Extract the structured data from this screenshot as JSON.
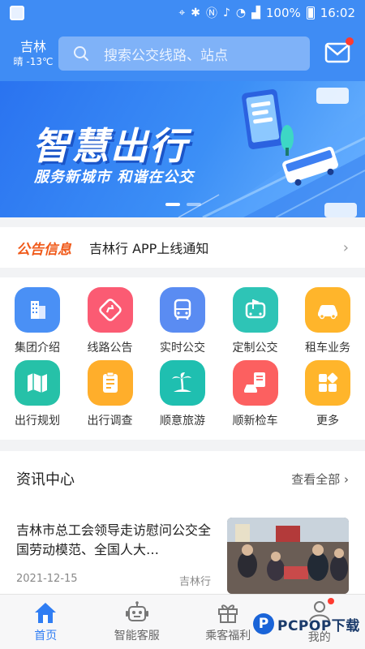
{
  "status_bar": {
    "battery": "100%",
    "time": "16:02"
  },
  "header": {
    "city": "吉林",
    "weather": "晴 -13℃",
    "search_placeholder": "搜索公交线路、站点"
  },
  "banner": {
    "title": "智慧出行",
    "slogan": "服务新城市 和谐在公交",
    "page_count": 2,
    "active_page": 1
  },
  "notice": {
    "tag": "公告信息",
    "text": "吉林行 APP上线通知"
  },
  "services": [
    {
      "label": "集团介绍",
      "icon": "building-icon",
      "color": "#4a90f5"
    },
    {
      "label": "线路公告",
      "icon": "route-icon",
      "color": "#fb5b73"
    },
    {
      "label": "实时公交",
      "icon": "bus-icon",
      "color": "#5a8cf2"
    },
    {
      "label": "定制公交",
      "icon": "flag-bus-icon",
      "color": "#2ec4b6"
    },
    {
      "label": "租车业务",
      "icon": "car-icon",
      "color": "#ffb52b"
    },
    {
      "label": "出行规划",
      "icon": "map-icon",
      "color": "#26c1a8"
    },
    {
      "label": "出行调查",
      "icon": "clipboard-icon",
      "color": "#ffae2b"
    },
    {
      "label": "顺意旅游",
      "icon": "palm-icon",
      "color": "#1fbfb0"
    },
    {
      "label": "顺新检车",
      "icon": "inspection-car-icon",
      "color": "#fc6060"
    },
    {
      "label": "更多",
      "icon": "grid-more-icon",
      "color": "#ffb52b"
    }
  ],
  "news": {
    "title": "资讯中心",
    "view_all": "查看全部",
    "items": [
      {
        "headline": "吉林市总工会领导走访慰问公交全国劳动模范、全国人大…",
        "date": "2021-12-15",
        "source": "吉林行"
      }
    ]
  },
  "tabs": [
    {
      "label": "首页",
      "icon": "home-icon",
      "active": true
    },
    {
      "label": "智能客服",
      "icon": "robot-icon",
      "active": false
    },
    {
      "label": "乘客福利",
      "icon": "gift-icon",
      "active": false
    },
    {
      "label": "我的",
      "icon": "user-icon",
      "active": false
    }
  ],
  "watermark": "PCPOP下载",
  "colors": {
    "primary": "#3f8cf4",
    "notice_tag": "#f05a1a",
    "active_tab": "#2f7df3",
    "badge": "#ff3b30"
  }
}
